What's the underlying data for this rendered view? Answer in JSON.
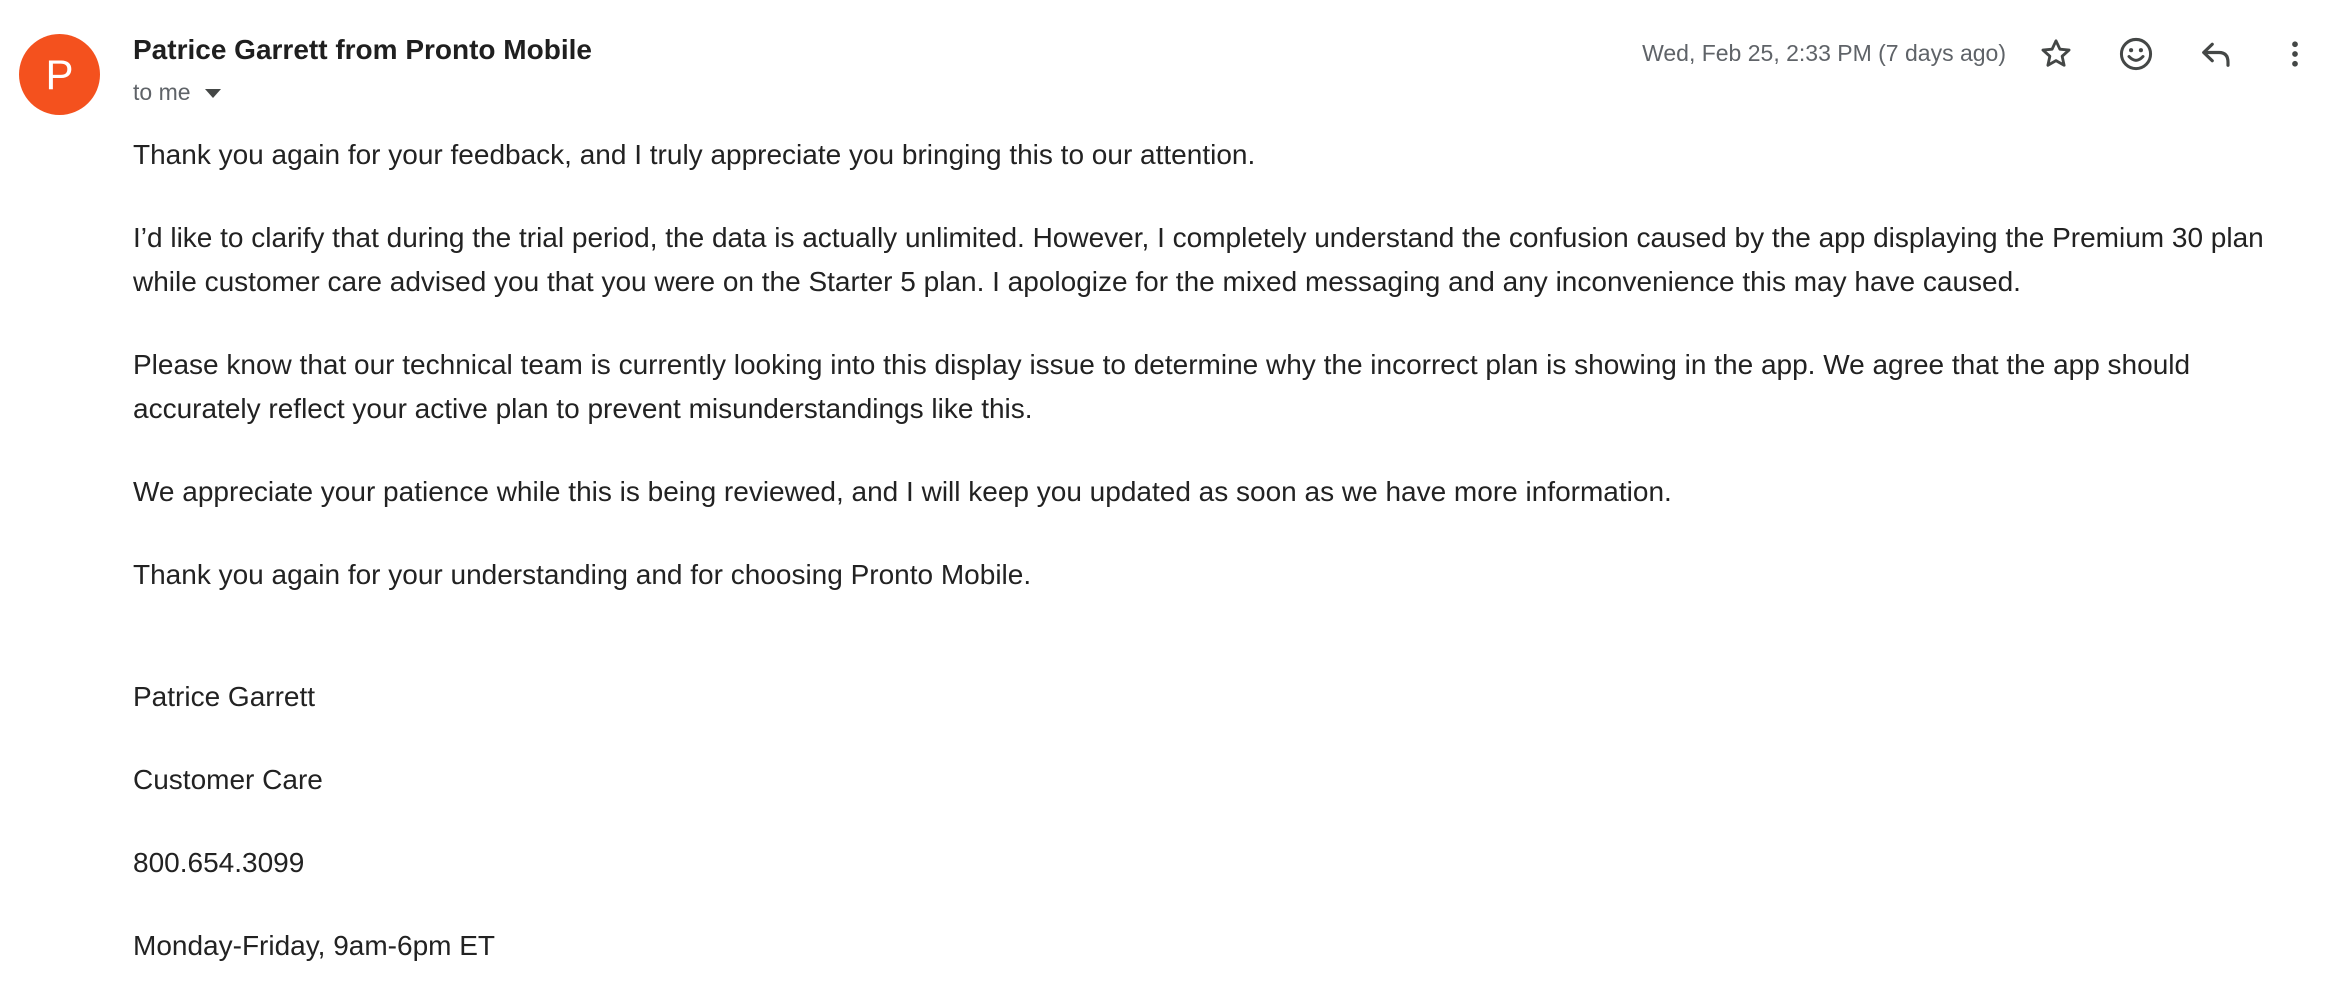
{
  "email": {
    "avatar_letter": "P",
    "sender": "Patrice Garrett from Pronto Mobile",
    "recipient": "to me",
    "timestamp": "Wed, Feb 25, 2:33 PM (7 days ago)",
    "paragraphs": [
      "Thank you again for your feedback, and I truly appreciate you bringing this to our attention.",
      "I’d like to clarify that during the trial period, the data is actually unlimited. However, I completely understand the confusion caused by the app displaying the Premium 30 plan while customer care advised you that you were on the Starter 5 plan. I apologize for the mixed messaging and any inconvenience this may have caused.",
      "Please know that our technical team is currently looking into this display issue to determine why the incorrect plan is showing in the app. We agree that the app should accurately reflect your active plan to prevent misunderstandings like this.",
      "We appreciate your patience while this is being reviewed, and I will keep you updated as soon as we have more information.",
      "Thank you again for your understanding and for choosing Pronto Mobile."
    ],
    "signature": {
      "name": "Patrice Garrett",
      "department": "Customer Care",
      "phone": "800.654.3099",
      "hours": "Monday-Friday, 9am-6pm ET"
    }
  },
  "actions": {
    "star": "star-icon",
    "emoji": "emoji-reaction-icon",
    "reply": "reply-icon",
    "more": "more-vert-icon"
  },
  "colors": {
    "avatar_bg": "#f4511e",
    "text": "#222222",
    "muted": "#5f6368",
    "icon": "#444746"
  }
}
